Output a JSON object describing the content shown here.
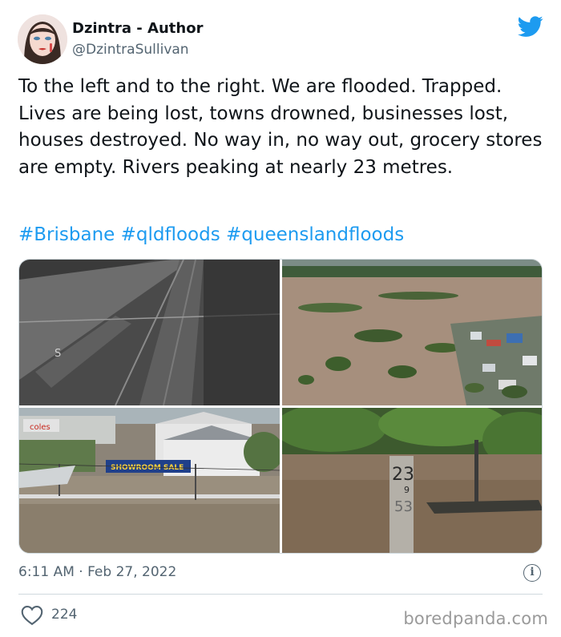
{
  "author": {
    "name": "Dzintra - Author",
    "handle": "@DzintraSullivan"
  },
  "tweet": {
    "text": "To the left and to the right. We are flooded. Trapped. Lives are being lost, towns drowned, businesses lost, houses destroyed. No way in, no way out, grocery stores are empty. Rivers peaking at nearly 23 metres.",
    "hashtags": [
      "#Brisbane",
      "#qldfloods",
      "#queenslandfloods"
    ]
  },
  "media": {
    "cam_label": "S",
    "store_sign": "coles",
    "banner_text": "SHOWROOM SALE",
    "gauge_top": "23",
    "gauge_mid": "9",
    "gauge_low": "53"
  },
  "meta": {
    "timestamp": "6:11 AM · Feb 27, 2022",
    "info_glyph": "i"
  },
  "actions": {
    "like_count": "224"
  },
  "watermark": "boredpanda.com",
  "icons": {
    "brand": "twitter-bird-icon",
    "like": "heart-icon",
    "info": "info-icon"
  },
  "colors": {
    "link": "#1d9bf0",
    "secondary_text": "#536471",
    "border": "#cfd9de"
  }
}
